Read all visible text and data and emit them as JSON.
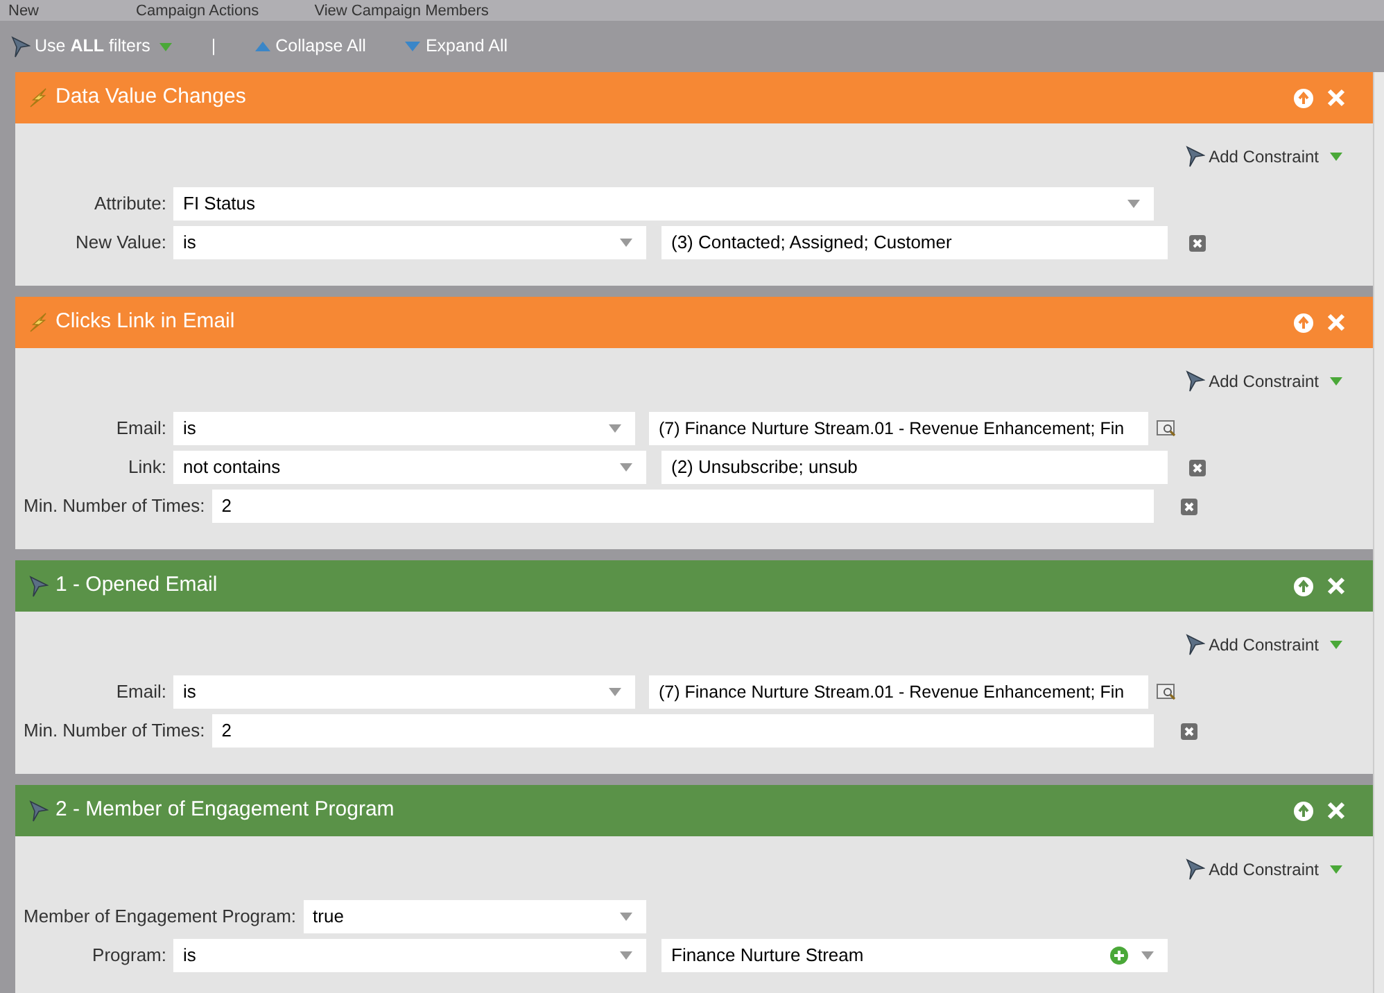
{
  "top_menu": [
    {
      "label": "New"
    },
    {
      "label": "Campaign Actions"
    },
    {
      "label": "View Campaign Members"
    }
  ],
  "toolbar": {
    "filter_logic": "Use **ALL** filters",
    "separator": "|",
    "collapse": "Collapse All",
    "expand": "Expand All"
  },
  "panels": [
    {
      "kind": "trigger",
      "title": "Data Value Changes",
      "add_constraint": "Add Constraint",
      "rows": [
        {
          "kind": "attribute",
          "label": "Attribute:",
          "operator": "FI Status"
        },
        {
          "kind": "operator",
          "label": "New Value:",
          "operator": "is",
          "value": "(3) Contacted; Assigned; Customer"
        }
      ]
    },
    {
      "kind": "trigger",
      "title": "Clicks Link in Email",
      "add_constraint": "Add Constraint",
      "rows": [
        {
          "kind": "lookup",
          "label": "Email:",
          "operator": "is",
          "value": "(7) Finance Nurture Stream.01 - Revenue Enhancement; Fin"
        },
        {
          "kind": "operator",
          "label": "Link:",
          "operator": "not contains",
          "value": "(2) Unsubscribe; unsub"
        },
        {
          "kind": "number",
          "label": "Min. Number of Times:",
          "value": "2"
        }
      ]
    },
    {
      "kind": "filter",
      "title": "1 - Opened Email",
      "add_constraint": "Add Constraint",
      "rows": [
        {
          "kind": "lookup",
          "label": "Email:",
          "operator": "is",
          "value": "(7) Finance Nurture Stream.01 - Revenue Enhancement; Fin"
        },
        {
          "kind": "number",
          "label": "Min. Number of Times:",
          "value": "2"
        }
      ]
    },
    {
      "kind": "filter",
      "title": "2 - Member of Engagement Program",
      "add_constraint": "Add Constraint",
      "rows": [
        {
          "kind": "boolean",
          "label": "Member of Engagement Program:",
          "operator": "true"
        },
        {
          "kind": "program",
          "label": "Program:",
          "operator": "is",
          "value": "Finance Nurture Stream"
        }
      ]
    }
  ]
}
